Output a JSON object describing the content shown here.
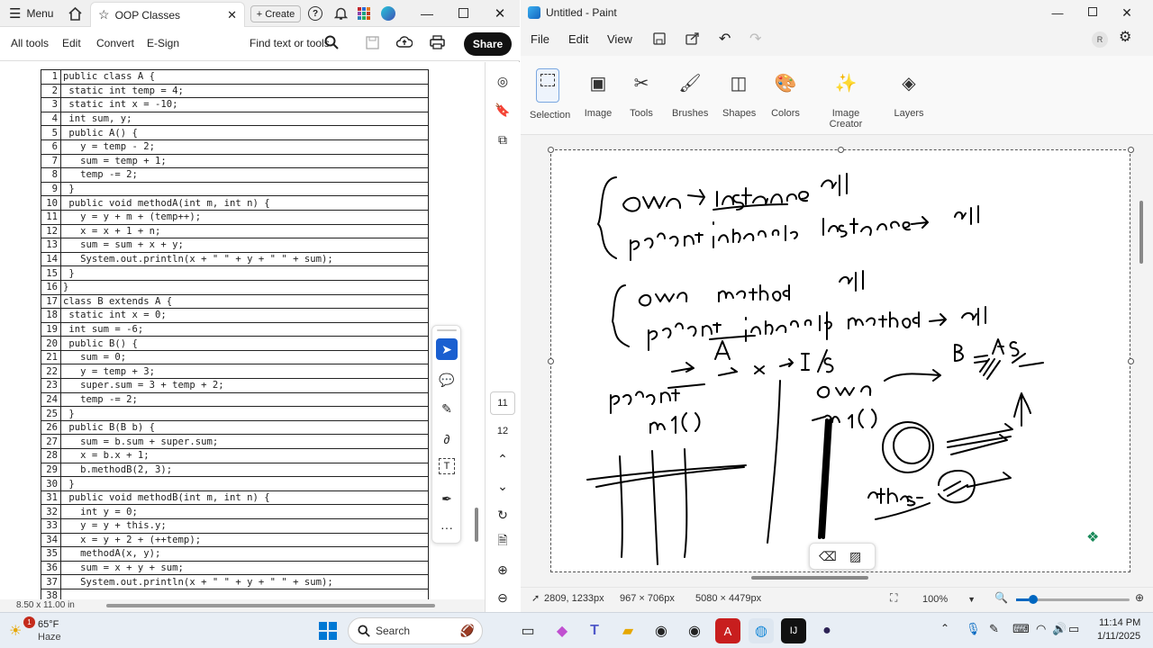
{
  "acrobat": {
    "menu_label": "Menu",
    "tab_title": "OOP Classes",
    "create_label": "Create",
    "toolbar": [
      "All tools",
      "Edit",
      "Convert",
      "E-Sign"
    ],
    "find_label": "Find text or tools",
    "share_label": "Share",
    "page_numbers": [
      "11",
      "12"
    ],
    "status": "8.50 x 11.00 in",
    "code_lines": [
      "public class A {",
      " static int temp = 4;",
      " static int x = -10;",
      " int sum, y;",
      " public A() {",
      "   y = temp - 2;",
      "   sum = temp + 1;",
      "   temp -= 2;",
      " }",
      " public void methodA(int m, int n) {",
      "   y = y + m + (temp++);",
      "   x = x + 1 + n;",
      "   sum = sum + x + y;",
      "   System.out.println(x + \" \" + y + \" \" + sum);",
      " }",
      "}",
      "class B extends A {",
      " static int x = 0;",
      " int sum = -6;",
      " public B() {",
      "   sum = 0;",
      "   y = temp + 3;",
      "   super.sum = 3 + temp + 2;",
      "   temp -= 2;",
      " }",
      " public B(B b) {",
      "   sum = b.sum + super.sum;",
      "   x = b.x + 1;",
      "   b.methodB(2, 3);",
      " }",
      " public void methodB(int m, int n) {",
      "   int y = 0;",
      "   y = y + this.y;",
      "   x = y + 2 + (++temp);",
      "   methodA(x, y);",
      "   sum = x + y + sum;",
      "   System.out.println(x + \" \" + y + \" \" + sum);",
      ""
    ]
  },
  "paint": {
    "title": "Untitled - Paint",
    "menus": [
      "File",
      "Edit",
      "View"
    ],
    "avatar_letter": "R",
    "ribbon": [
      "Selection",
      "Image",
      "Tools",
      "Brushes",
      "Shapes",
      "Colors",
      "Image Creator",
      "Layers"
    ],
    "status": {
      "cursor": "2809, 1233px",
      "selection": "967 × 706px",
      "canvas": "5080 × 4479px",
      "zoom": "100%"
    }
  },
  "taskbar": {
    "weather_temp": "65°F",
    "weather_desc": "Haze",
    "weather_badge": "1",
    "search_placeholder": "Search",
    "time": "11:14 PM",
    "date": "1/11/2025"
  },
  "colors": {
    "share_bg": "#111111",
    "select_tool": "#1a5fd0",
    "accent": "#0067c0"
  }
}
